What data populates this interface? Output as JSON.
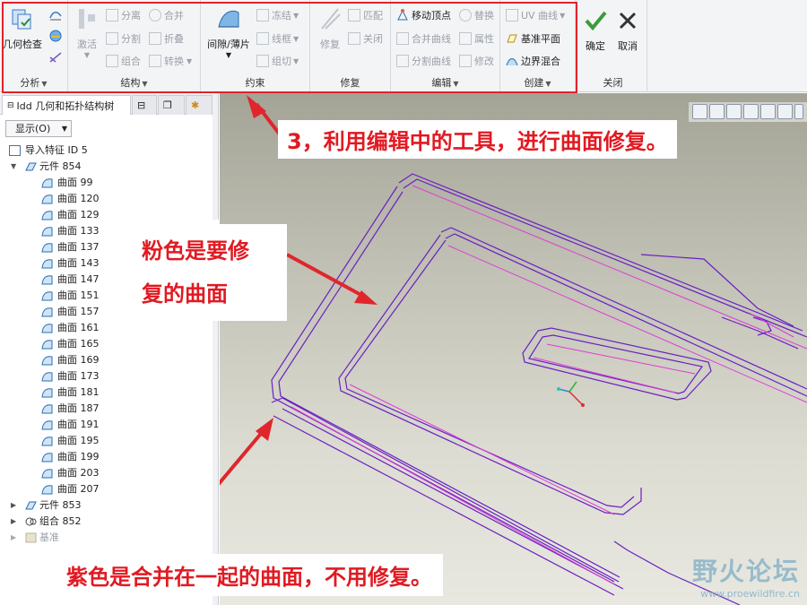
{
  "ribbon": {
    "analysis": {
      "title": "分析",
      "geometry_check": "几何检查"
    },
    "structure": {
      "title": "结构",
      "activate": "激活",
      "separate": "分离",
      "split": "分割",
      "combine": "组合",
      "merge": "合并",
      "fold": "折叠",
      "convert": "转换"
    },
    "constraints": {
      "title": "约束",
      "gap_patch": "间隙/薄片",
      "add": "冻结",
      "wireframe": "线框",
      "groupcut": "组切"
    },
    "repair": {
      "title": "修复",
      "repair": "修复",
      "match": "匹配",
      "close": "关闭"
    },
    "edit": {
      "title": "编辑",
      "move_vertex": "移动顶点",
      "replace": "替换",
      "merge_curves": "合并曲线",
      "attributes": "属性",
      "split_curves": "分割曲线",
      "modify": "修改"
    },
    "create": {
      "title": "创建",
      "uv_curve": "UV 曲线",
      "datum_plane": "基准平面",
      "boundary_blend": "边界混合"
    },
    "close_group": {
      "title": "关闭",
      "ok": "确定",
      "cancel": "取消"
    }
  },
  "panel": {
    "tab_label": "Idd 几何和拓扑结构树",
    "show_button": "显示(O)",
    "tree": {
      "import_feature": "导入特征 ID 5",
      "element_854": "元件 854",
      "surfaces": [
        "曲面 99",
        "曲面 120",
        "曲面 129",
        "曲面 133",
        "曲面 137",
        "曲面 143",
        "曲面 147",
        "曲面 151",
        "曲面 157",
        "曲面 161",
        "曲面 165",
        "曲面 169",
        "曲面 173",
        "曲面 181",
        "曲面 187",
        "曲面 191",
        "曲面 195",
        "曲面 199",
        "曲面 203",
        "曲面 207"
      ],
      "element_853": "元件 853",
      "combine_852": "组合 852",
      "datum": "基准"
    }
  },
  "annotations": {
    "step3": "3，利用编辑中的工具，进行曲面修复。",
    "pink_line1": "粉色是要修",
    "pink_line2": "复的曲面",
    "purple": "紫色是合并在一起的曲面，不用修复。"
  },
  "watermark": {
    "name": "野火论坛",
    "url": "www.proewildfire.cn"
  },
  "colors": {
    "callout_text": "#e11a22",
    "arrow": "#e0262c",
    "purple_edges": "#6a1fc2",
    "pink_edges": "#e03ad6"
  }
}
